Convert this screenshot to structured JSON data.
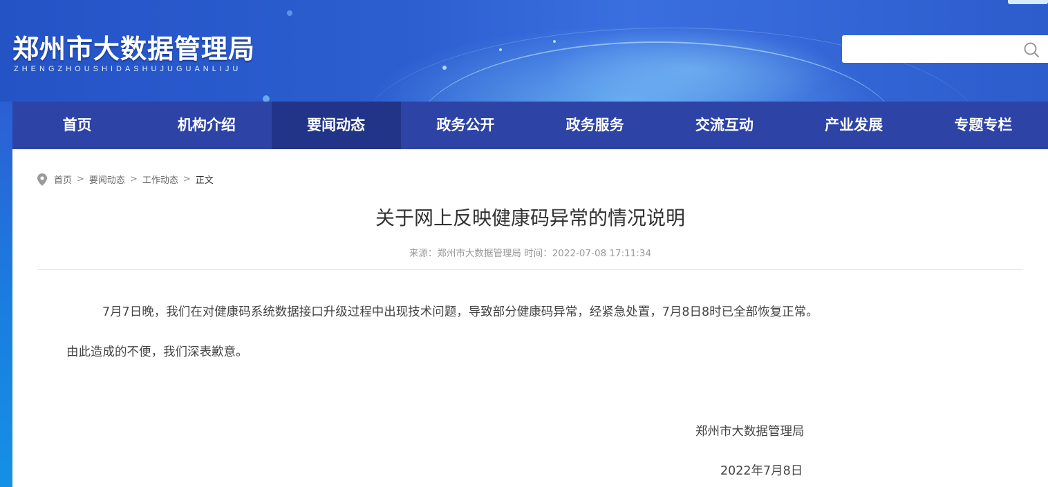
{
  "header": {
    "title": "郑州市大数据管理局",
    "subtitle": "ZHENGZHOUSHIDASHUJUGUANLIJU",
    "search": {
      "value": "",
      "placeholder": ""
    },
    "search_icon": "search-icon"
  },
  "nav": {
    "items": [
      {
        "label": "首页",
        "active": false
      },
      {
        "label": "机构介绍",
        "active": false
      },
      {
        "label": "要闻动态",
        "active": true
      },
      {
        "label": "政务公开",
        "active": false
      },
      {
        "label": "政务服务",
        "active": false
      },
      {
        "label": "交流互动",
        "active": false
      },
      {
        "label": "产业发展",
        "active": false
      },
      {
        "label": "专题专栏",
        "active": false
      }
    ]
  },
  "breadcrumb": {
    "icon": "location-pin-icon",
    "items": [
      "首页",
      "要闻动态",
      "工作动态"
    ],
    "separator": ">",
    "current": "正文"
  },
  "article": {
    "title": "关于网上反映健康码异常的情况说明",
    "meta": "来源：郑州市大数据管理局  时间：2022-07-08 17:11:34",
    "paragraphs": [
      "7月7日晚，我们在对健康码系统数据接口升级过程中出现技术问题，导致部分健康码异常，经紧急处置，7月8日8时已全部恢复正常。",
      "由此造成的不便，我们深表歉意。"
    ],
    "signature_org": "郑州市大数据管理局",
    "signature_date": "2022年7月8日"
  },
  "colors": {
    "nav_bg": "#2d43a6",
    "nav_active_bg": "#223487",
    "header_bg": "#2d5fd1"
  }
}
